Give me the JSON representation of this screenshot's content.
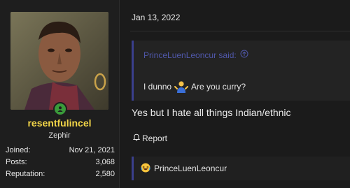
{
  "user": {
    "name": "resentfulincel",
    "title": "Zephir",
    "stats": [
      {
        "label": "Joined:",
        "value": "Nov 21, 2021"
      },
      {
        "label": "Posts:",
        "value": "3,068"
      },
      {
        "label": "Reputation:",
        "value": "2,580"
      }
    ],
    "online": true
  },
  "post": {
    "date": "Jan 13, 2022",
    "quote": {
      "author_said": "PrinceLuenLeoncur said:",
      "text_before": "I dunno",
      "text_after": "Are you curry?"
    },
    "body": "Yes but I hate all things Indian/ethnic",
    "report_label": "Report",
    "reaction_user": "PrinceLuenLeoncur"
  },
  "colors": {
    "username": "#f2d548",
    "quote_accent": "#3a3f8c",
    "quote_author": "#4f57a8",
    "online": "#3a9b3a",
    "background": "#1b1b1b"
  }
}
